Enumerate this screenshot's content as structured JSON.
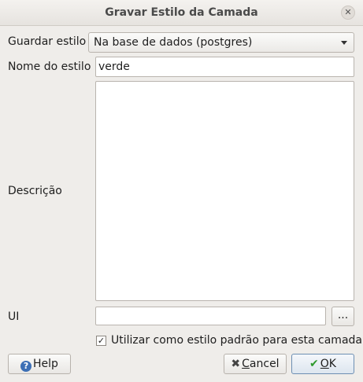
{
  "window": {
    "title": "Gravar Estilo da Camada",
    "close_glyph": "✕"
  },
  "form": {
    "save_style_label": "Guardar estilo",
    "save_style_value": "Na base de dados (postgres)",
    "style_name_label": "Nome do estilo",
    "style_name_value": "verde",
    "description_label": "Descrição",
    "description_value": "",
    "ui_label": "UI",
    "ui_value": "",
    "browse_label": "...",
    "default_checked": true,
    "default_check_glyph": "✓",
    "default_label": "Utilizar como estilo padrão para esta camada"
  },
  "buttons": {
    "help_label": "Help",
    "cancel_label_first": "C",
    "cancel_label_rest": "ancel",
    "ok_label_first": "O",
    "ok_label_rest": "K"
  },
  "icons": {
    "help": "help-icon",
    "cancel": "cancel-icon",
    "ok": "ok-checkmark-icon",
    "close": "close-icon",
    "dropdown": "chevron-down-icon"
  },
  "colors": {
    "background": "#efedea",
    "ok_check": "#2e9a2e",
    "help_icon": "#3c6fb5"
  }
}
